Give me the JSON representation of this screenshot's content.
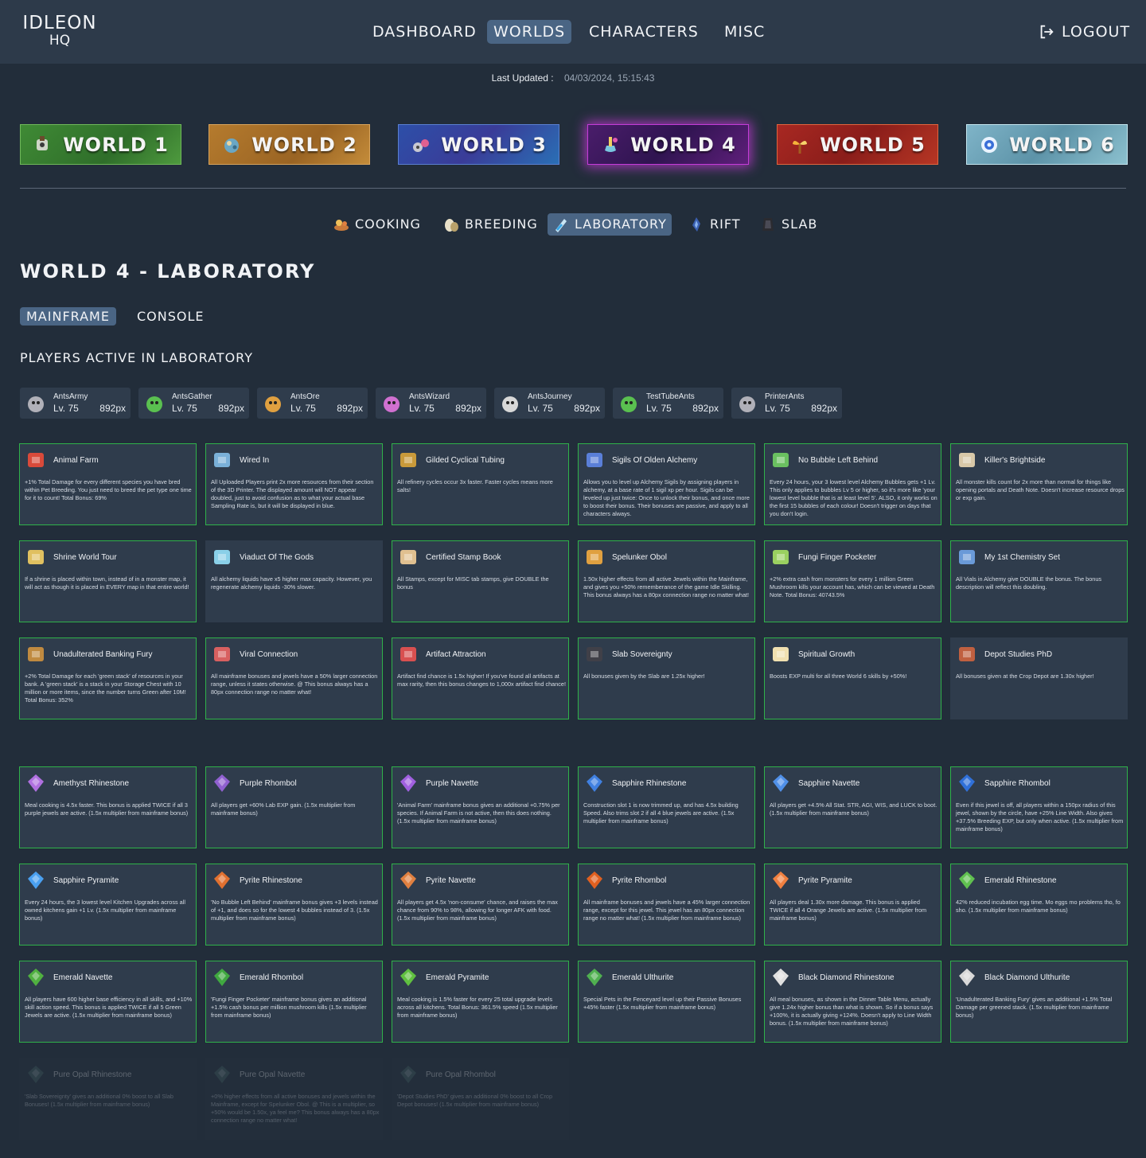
{
  "app": {
    "logo_line1": "IDLEON",
    "logo_line2": "HQ"
  },
  "nav": {
    "dashboard": "DASHBOARD",
    "worlds": "WORLDS",
    "characters": "CHARACTERS",
    "misc": "MISC",
    "logout": "LOGOUT"
  },
  "last_updated": {
    "label": "Last Updated :",
    "value": "04/03/2024, 15:15:43"
  },
  "worlds": [
    "WORLD 1",
    "WORLD 2",
    "WORLD 3",
    "WORLD 4",
    "WORLD 5",
    "WORLD 6"
  ],
  "subtabs": [
    "COOKING",
    "BREEDING",
    "LABORATORY",
    "RIFT",
    "SLAB"
  ],
  "page_title": "WORLD 4 - LABORATORY",
  "page_tabs": {
    "mainframe": "MAINFRAME",
    "console": "CONSOLE"
  },
  "players_title": "PLAYERS ACTIVE IN LABORATORY",
  "players": [
    {
      "name": "AntsArmy",
      "level": "Lv. 75",
      "px": "892px"
    },
    {
      "name": "AntsGather",
      "level": "Lv. 75",
      "px": "892px"
    },
    {
      "name": "AntsOre",
      "level": "Lv. 75",
      "px": "892px"
    },
    {
      "name": "AntsWizard",
      "level": "Lv. 75",
      "px": "892px"
    },
    {
      "name": "AntsJourney",
      "level": "Lv. 75",
      "px": "892px"
    },
    {
      "name": "TestTubeAnts",
      "level": "Lv. 75",
      "px": "892px"
    },
    {
      "name": "PrinterAnts",
      "level": "Lv. 75",
      "px": "892px"
    }
  ],
  "bonuses": [
    {
      "title": "Animal Farm",
      "desc": "+1% Total Damage for every different species you have bred within Pet Breeding. You just need to breed the pet type one time for it to count! Total Bonus: 69%"
    },
    {
      "title": "Wired In",
      "desc": "All Uploaded Players print 2x more resources from their section of the 3D Printer. The displayed amount will NOT appear doubled, just to avoid confusion as to what your actual base Sampling Rate is, but it will be displayed in blue."
    },
    {
      "title": "Gilded Cyclical Tubing",
      "desc": "All refinery cycles occur 3x faster. Faster cycles means more salts!"
    },
    {
      "title": "Sigils Of Olden Alchemy",
      "desc": "Allows you to level up Alchemy Sigils by assigning players in alchemy, at a base rate of 1 sigil xp per hour. Sigils can be leveled up just twice: Once to unlock their bonus, and once more to boost their bonus. Their bonuses are passive, and apply to all characters always."
    },
    {
      "title": "No Bubble Left Behind",
      "desc": "Every 24 hours, your 3 lowest level Alchemy Bubbles gets +1 Lv. This only applies to bubbles Lv 5 or higher, so it's more like 'your lowest level bubble that is at least level 5'. ALSO, it only works on the first 15 bubbles of each colour! Doesn't trigger on days that you don't login."
    },
    {
      "title": "Killer's Brightside",
      "desc": "All monster kills count for 2x more than normal for things like opening portals and Death Note. Doesn't increase resource drops or exp gain."
    },
    {
      "title": "Shrine World Tour",
      "desc": "If a shrine is placed within town, instead of in a monster map, it will act as though it is placed in EVERY map in that entire world!"
    },
    {
      "title": "Viaduct Of The Gods",
      "desc": "All alchemy liquids have x5 higher max capacity. However, you regenerate alchemy liquids -30% slower."
    },
    {
      "title": "Certified Stamp Book",
      "desc": "All Stamps, except for MISC tab stamps, give DOUBLE the bonus"
    },
    {
      "title": "Spelunker Obol",
      "desc": "1.50x higher effects from all active Jewels within the Mainframe, and gives you +50% rememberance of the game Idle Skilling. This bonus always has a 80px connection range no matter what!"
    },
    {
      "title": "Fungi Finger Pocketer",
      "desc": "+2% extra cash from monsters for every 1 million Green Mushroom kills your account has, which can be viewed at Death Note. Total Bonus: 40743.5%"
    },
    {
      "title": "My 1st Chemistry Set",
      "desc": "All Vials in Alchemy give DOUBLE the bonus. The bonus description will reflect this doubling."
    },
    {
      "title": "Unadulterated Banking Fury",
      "desc": "+2% Total Damage for each 'green stack' of resources in your bank. A 'green stack' is a stack in your Storage Chest with 10 million or more items, since the number turns Green after 10M! Total Bonus: 352%"
    },
    {
      "title": "Viral Connection",
      "desc": "All mainframe bonuses and jewels have a 50% larger connection range, unless it states otherwise. @ This bonus always has a 80px connection range no matter what!"
    },
    {
      "title": "Artifact Attraction",
      "desc": "Artifact find chance is 1.5x higher! If you've found all artifacts at max rarity, then this bonus changes to 1,000x artifact find chance!"
    },
    {
      "title": "Slab Sovereignty",
      "desc": "All bonuses given by the Slab are 1.25x higher!"
    },
    {
      "title": "Spiritual Growth",
      "desc": "Boosts EXP multi for all three World 6 skills by +50%!"
    },
    {
      "title": "Depot Studies PhD",
      "desc": "All bonuses given at the Crop Depot are 1.30x higher!"
    }
  ],
  "jewels": [
    {
      "title": "Amethyst Rhinestone",
      "desc": "Meal cooking is 4.5x faster. This bonus is applied TWICE if all 3 purple jewels are active. (1.5x multiplier from mainframe bonus)"
    },
    {
      "title": "Purple Rhombol",
      "desc": "All players get +60% Lab EXP gain. (1.5x multiplier from mainframe bonus)"
    },
    {
      "title": "Purple Navette",
      "desc": "'Animal Farm' mainframe bonus gives an additional +0.75% per species. If Animal Farm is not active, then this does nothing. (1.5x multiplier from mainframe bonus)"
    },
    {
      "title": "Sapphire Rhinestone",
      "desc": "Construction slot 1 is now trimmed up, and has 4.5x building Speed. Also trims slot 2 if all 4 blue jewels are active. (1.5x multiplier from mainframe bonus)"
    },
    {
      "title": "Sapphire Navette",
      "desc": "All players get +4.5% All Stat. STR, AGI, WIS, and LUCK to boot. (1.5x multiplier from mainframe bonus)"
    },
    {
      "title": "Sapphire Rhombol",
      "desc": "Even if this jewel is off, all players within a 150px radius of this jewel, shown by the circle, have +25% Line Width. Also gives +37.5% Breeding EXP, but only when active. (1.5x multiplier from mainframe bonus)"
    },
    {
      "title": "Sapphire Pyramite",
      "desc": "Every 24 hours, the 3 lowest level Kitchen Upgrades across all owned kitchens gain +1 Lv. (1.5x multiplier from mainframe bonus)"
    },
    {
      "title": "Pyrite Rhinestone",
      "desc": "'No Bubble Left Behind' mainframe bonus gives +3 levels instead of +1, and does so for the lowest 4 bubbles instead of 3. (1.5x multiplier from mainframe bonus)"
    },
    {
      "title": "Pyrite Navette",
      "desc": "All players get 4.5x 'non-consume' chance, and raises the max chance from 90% to 98%, allowing for longer AFK with food. (1.5x multiplier from mainframe bonus)"
    },
    {
      "title": "Pyrite Rhombol",
      "desc": "All mainframe bonuses and jewels have a 45% larger connection range, except for this jewel. This jewel has an 80px connection range no matter what! (1.5x multiplier from mainframe bonus)"
    },
    {
      "title": "Pyrite Pyramite",
      "desc": "All players deal 1.30x more damage. This bonus is applied TWICE if all 4 Orange Jewels are active. (1.5x multiplier from mainframe bonus)"
    },
    {
      "title": "Emerald Rhinestone",
      "desc": "42% reduced incubation egg time. Mo eggs mo problems tho, fo sho. (1.5x multiplier from mainframe bonus)"
    },
    {
      "title": "Emerald Navette",
      "desc": "All players have 600 higher base efficiency in all skills, and +10% skill action speed. This bonus is applied TWICE if all 5 Green Jewels are active. (1.5x multiplier from mainframe bonus)"
    },
    {
      "title": "Emerald Rhombol",
      "desc": "'Fungi Finger Pocketer' mainframe bonus gives an additional +1.5% cash bonus per million mushroom kills (1.5x multiplier from mainframe bonus)"
    },
    {
      "title": "Emerald Pyramite",
      "desc": "Meal cooking is 1.5% faster for every 25 total upgrade levels across all kitchens. Total Bonus: 361.5% speed (1.5x multiplier from mainframe bonus)"
    },
    {
      "title": "Emerald Ulthurite",
      "desc": "Special Pets in the Fenceyard level up their Passive Bonuses +45% faster (1.5x multiplier from mainframe bonus)"
    },
    {
      "title": "Black Diamond Rhinestone",
      "desc": "All meal bonuses, as shown in the Dinner Table Menu, actually give 1.24x higher bonus than what is shown. So if a bonus says +100%, it is actually giving +124%. Doesn't apply to Line Width bonus. (1.5x multiplier from mainframe bonus)"
    },
    {
      "title": "Black Diamond Ulthurite",
      "desc": "'Unadulterated Banking Fury' gives an additional +1.5% Total Damage per greened stack. (1.5x multiplier from mainframe bonus)"
    },
    {
      "title": "Pure Opal Rhinestone",
      "desc": "'Slab Sovereignty' gives an additional 0% boost to all Slab Bonuses! (1.5x multiplier from mainframe bonus)"
    },
    {
      "title": "Pure Opal Navette",
      "desc": "+0% higher effects from all active bonuses and jewels within the Mainframe, except for Spelunker Obol. @ This is a multiplier, so +50% would be 1.50x, ya feel me? This bonus always has a 80px connection range no matter what!"
    },
    {
      "title": "Pure Opal Rhombol",
      "desc": "'Depot Studies PhD' gives an additional 0% boost to all Crop Depot bonuses! (1.5x multiplier from mainframe bonus)"
    }
  ]
}
